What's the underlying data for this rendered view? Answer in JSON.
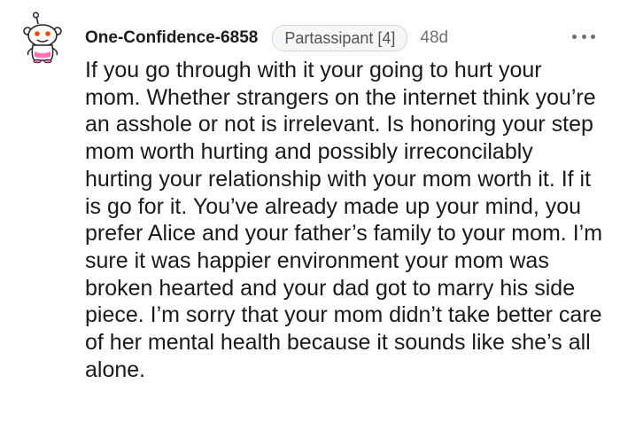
{
  "comment": {
    "author": "One-Confidence-6858",
    "flair": "Partassipant [4]",
    "age": "48d",
    "body": "If you go through with it your going to hurt your mom. Whether strangers on the internet think you’re an asshole or not is irrelevant. Is honoring your step mom worth hurting and possibly irreconcilably hurting your relationship with your mom worth it. If it is go for it. You’ve already made up your mind, you prefer Alice and your father’s family to your mom. I’m sure it was happier environment your mom was broken hearted and your dad got to marry his side piece. I’m sorry that your mom didn’t take better care of her mental health because it sounds like she’s all alone."
  },
  "icons": {
    "avatar": "snoo-avatar-icon",
    "menu": "more-options-icon"
  }
}
